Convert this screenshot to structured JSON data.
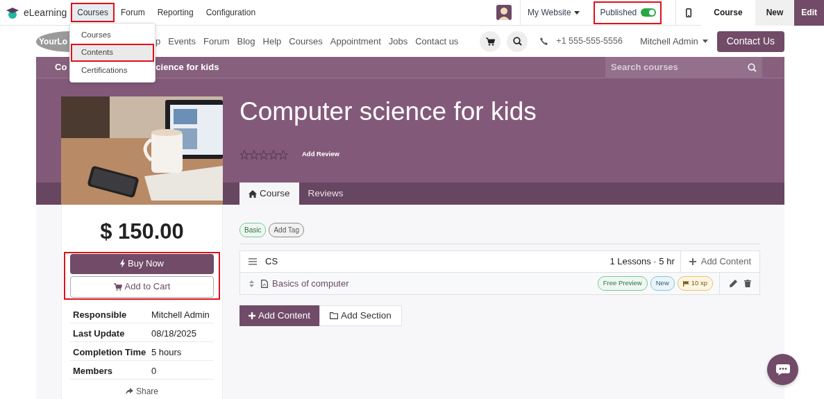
{
  "app_bar": {
    "app_name": "eLearning",
    "menu": [
      {
        "label": "Courses",
        "selected": true,
        "highlighted": true
      },
      {
        "label": "Forum",
        "selected": false,
        "highlighted": false
      },
      {
        "label": "Reporting",
        "selected": false,
        "highlighted": false
      },
      {
        "label": "Configuration",
        "selected": false,
        "highlighted": false
      }
    ],
    "website_selector": "My Website",
    "published": {
      "label": "Published",
      "on": true,
      "highlighted": true
    },
    "actions": [
      {
        "label": "Course",
        "kind": "plain"
      },
      {
        "label": "New",
        "kind": "light"
      },
      {
        "label": "Edit",
        "kind": "primary"
      }
    ]
  },
  "dropdown": {
    "items": [
      {
        "label": "Courses",
        "selected": false,
        "highlighted": false
      },
      {
        "label": "Contents",
        "selected": true,
        "highlighted": true
      },
      {
        "label": "Certifications",
        "selected": false,
        "highlighted": false
      }
    ]
  },
  "site_nav": {
    "logo": "YourLo",
    "items": [
      "p",
      "Events",
      "Forum",
      "Blog",
      "Help",
      "Courses",
      "Appointment",
      "Jobs",
      "Contact us"
    ],
    "phone": "+1 555-555-5556",
    "user": "Mitchell Admin",
    "cta": "Contact Us"
  },
  "breadcrumb": {
    "parts": [
      "Co",
      "cience for kids"
    ],
    "search_placeholder": "Search courses"
  },
  "course": {
    "title": "Computer science for kids",
    "stars": 0,
    "review_link": "Add Review",
    "tabs": [
      {
        "label": "Course",
        "selected": true
      },
      {
        "label": "Reviews",
        "selected": false
      }
    ],
    "price": "$ 150.00",
    "purchase": {
      "highlighted": true,
      "buy": "Buy Now",
      "cart": "Add to Cart"
    },
    "details": [
      {
        "label": "Responsible",
        "value": "Mitchell Admin"
      },
      {
        "label": "Last Update",
        "value": "08/18/2025"
      },
      {
        "label": "Completion Time",
        "value": "5 hours"
      },
      {
        "label": "Members",
        "value": "0"
      }
    ],
    "share": "Share"
  },
  "tags": [
    {
      "label": "Basic",
      "kind": "tag"
    },
    {
      "label": "Add Tag",
      "kind": "add"
    }
  ],
  "sections": [
    {
      "name": "CS",
      "summary": "1 Lessons · 5 hr",
      "add": "Add Content",
      "lessons": [
        {
          "title": "Basics of computer",
          "badges": [
            {
              "label": "Free Preview",
              "kind": "preview"
            },
            {
              "label": "New",
              "kind": "new"
            },
            {
              "label": "10 xp",
              "kind": "xp"
            }
          ]
        }
      ]
    }
  ],
  "buttons": {
    "add_content": "Add Content",
    "add_section": "Add Section"
  }
}
